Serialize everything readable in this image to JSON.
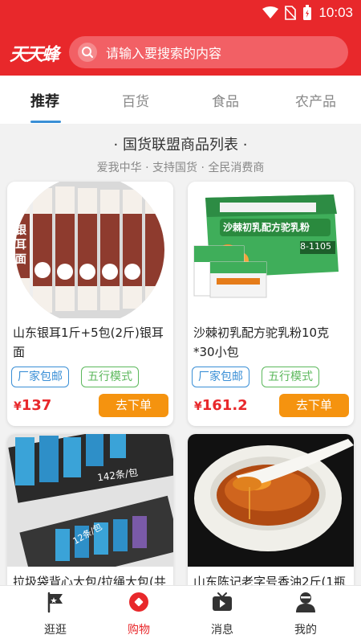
{
  "status_bar": {
    "time": "10:03"
  },
  "header": {
    "logo_text": "天天蜂",
    "search_placeholder": "请输入要搜索的内容"
  },
  "tabs": [
    {
      "label": "推荐",
      "active": true
    },
    {
      "label": "百货",
      "active": false
    },
    {
      "label": "食品",
      "active": false
    },
    {
      "label": "农产品",
      "active": false
    }
  ],
  "section": {
    "title": "· 国货联盟商品列表 ·",
    "subtitle": "爱我中华 · 支持国货 · 全民消费商"
  },
  "products": [
    {
      "title": "山东银耳1斤+5包(2斤)银耳面",
      "tags": [
        "厂家包邮",
        "五行模式"
      ],
      "currency": "¥",
      "price": "137",
      "button": "去下单",
      "image_text": "银耳面"
    },
    {
      "title": "沙棘初乳配方驼乳粉10克*30小包",
      "tags": [
        "厂家包邮",
        "五行模式"
      ],
      "currency": "¥",
      "price": "161.2",
      "button": "去下单",
      "image_text": "沙棘初乳配方驼乳粉",
      "image_text_2": "8-1105"
    },
    {
      "title": "拉圾袋背心大包/拉绳大包(共",
      "image_text": "142条/包",
      "image_text_2": "12条/包"
    },
    {
      "title": "山东陈记老字号香油2斤(1瓶"
    }
  ],
  "bottom_nav": [
    {
      "label": "逛逛",
      "icon": "flag-icon",
      "active": false
    },
    {
      "label": "购物",
      "icon": "shopping-icon",
      "active": true
    },
    {
      "label": "消息",
      "icon": "tv-message-icon",
      "active": false
    },
    {
      "label": "我的",
      "icon": "user-icon",
      "active": false
    }
  ],
  "colors": {
    "brand_red": "#e8282b",
    "tab_accent": "#3a8fd6",
    "tag_green": "#5cb85c",
    "button_orange": "#f5930f"
  }
}
